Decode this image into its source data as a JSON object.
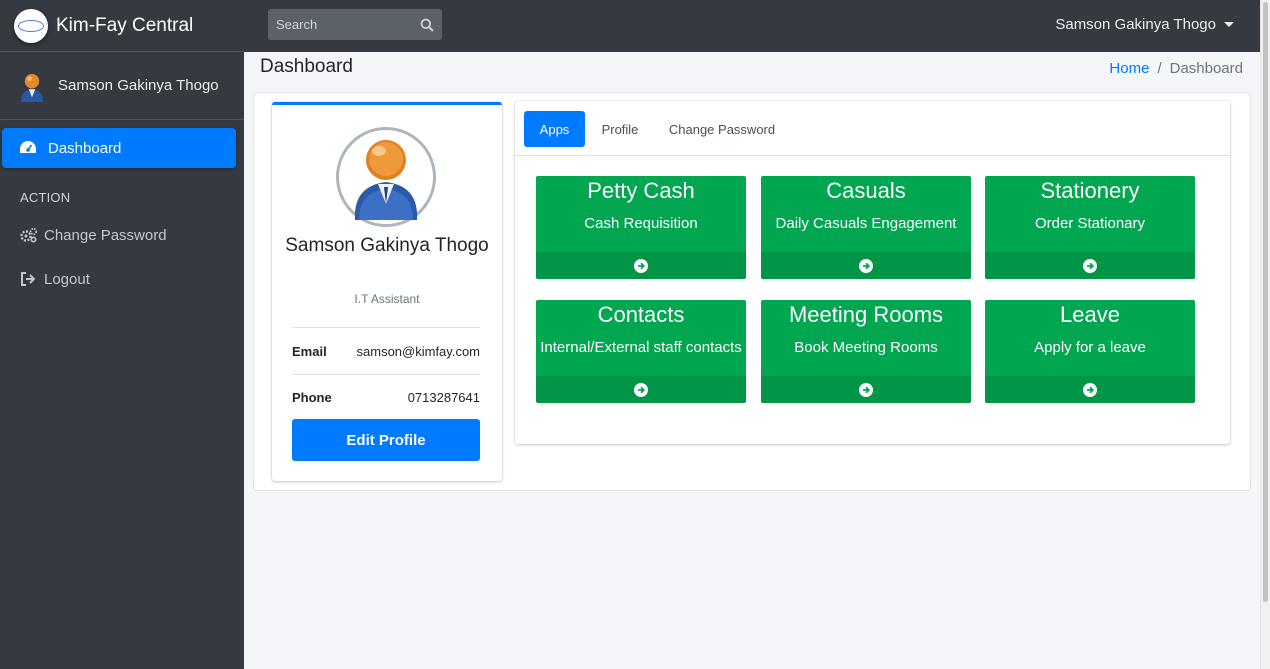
{
  "brand": {
    "name": "Kim-Fay Central",
    "logo_icon": "kimfay-logo-icon"
  },
  "topbar": {
    "search_placeholder": "Search",
    "user_menu_label": "Samson Gakinya Thogo"
  },
  "sidebar": {
    "user_name": "Samson Gakinya Thogo",
    "active_item": {
      "label": "Dashboard",
      "icon": "tachometer-icon"
    },
    "section_header": "ACTION",
    "links": [
      {
        "label": "Change Password",
        "icon": "gears-icon"
      },
      {
        "label": "Logout",
        "icon": "sign-out-icon"
      }
    ]
  },
  "content_header": {
    "title": "Dashboard",
    "breadcrumb": {
      "home": "Home",
      "separator": "/",
      "current": "Dashboard"
    }
  },
  "profile": {
    "name": "Samson Gakinya Thogo",
    "role": "I.T Assistant",
    "email_label": "Email",
    "email": "samson@kimfay.com",
    "phone_label": "Phone",
    "phone": "0713287641",
    "edit_button": "Edit Profile"
  },
  "tabs": {
    "apps": "Apps",
    "profile": "Profile",
    "change_password": "Change Password",
    "active": "Apps"
  },
  "apps": [
    {
      "title": "Petty Cash",
      "subtitle": "Cash Requisition"
    },
    {
      "title": "Casuals",
      "subtitle": "Daily Casuals Engagement"
    },
    {
      "title": "Stationery",
      "subtitle": "Order Stationary"
    },
    {
      "title": "Contacts",
      "subtitle": "Internal/External staff contacts"
    },
    {
      "title": "Meeting Rooms",
      "subtitle": "Book Meeting Rooms"
    },
    {
      "title": "Leave",
      "subtitle": "Apply for a leave"
    }
  ],
  "colors": {
    "sidebar_bg": "#343a40",
    "accent": "#007bff",
    "tile_green": "#00a650"
  }
}
